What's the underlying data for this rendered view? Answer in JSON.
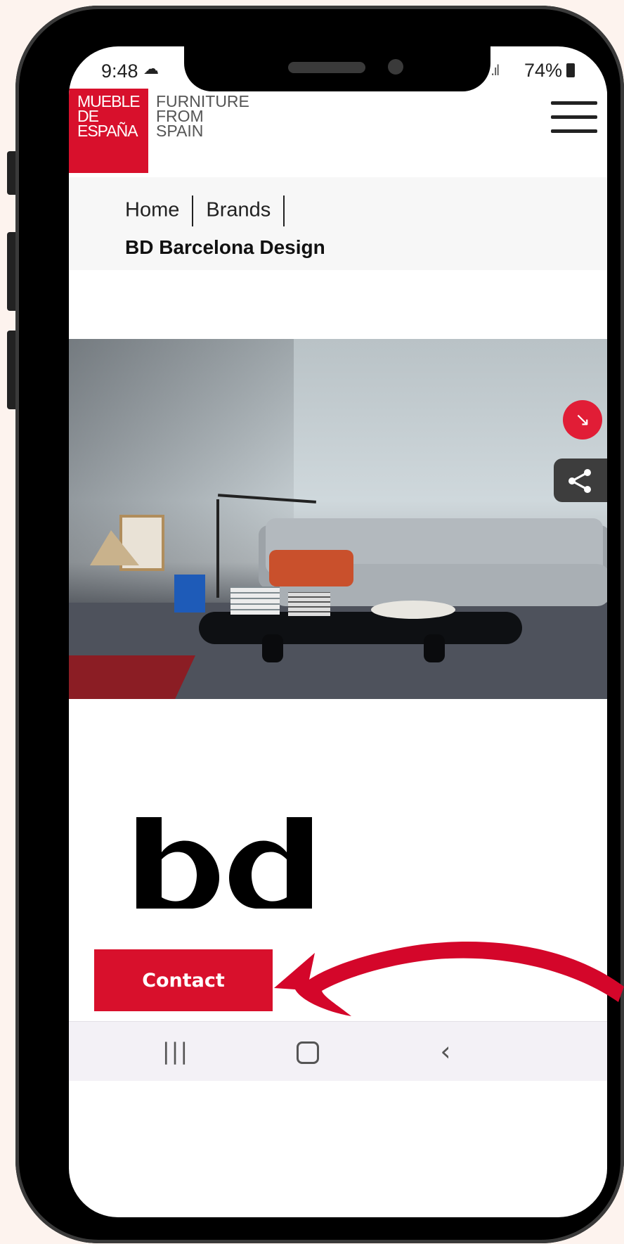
{
  "status_bar": {
    "time": "9:48",
    "battery": "74%"
  },
  "header": {
    "logo_lines": [
      "MUEBLE",
      "DE",
      "ESPAÑA"
    ],
    "tagline_lines": [
      "FURNITURE",
      "FROM",
      "SPAIN"
    ],
    "brand_color": "#d8102c"
  },
  "breadcrumb": {
    "items": [
      "Home",
      "Brands"
    ],
    "current": "BD Barcelona Design"
  },
  "floating": {
    "arrow_icon": "arrow-down-right-icon",
    "share_icon": "share-icon",
    "accent": "#e11d36"
  },
  "brand_logo": "bd",
  "contact_label": "Contact",
  "nav": {
    "recent_icon": "|||",
    "home_icon": "home-icon",
    "back_icon": "‹"
  },
  "annotation_color": "#d4062a"
}
